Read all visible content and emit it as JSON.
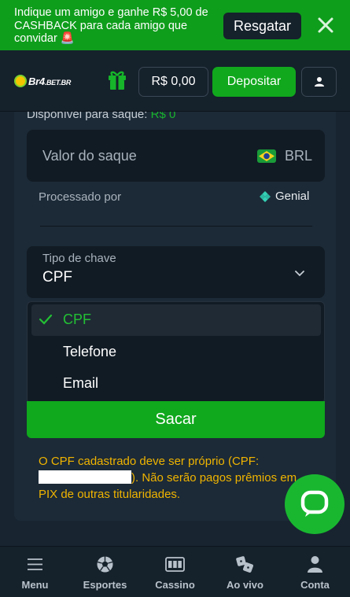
{
  "promo": {
    "text": "Indique um amigo e ganhe R$ 5,00 de CASHBACK para cada amigo que convidar 🚨",
    "button_label": "Resgatar",
    "close_icon": "close-icon"
  },
  "header": {
    "logo_main": "Br4",
    "logo_domain": ".BET.BR",
    "gift_icon": "gift-icon",
    "balance": "R$ 0,00",
    "deposit_label": "Depositar",
    "user_icon": "user-icon"
  },
  "withdraw": {
    "available_label": "Disponível para saque:",
    "available_amount": "R$ 0",
    "amount_placeholder": "Valor do saque",
    "currency": "BRL",
    "processed_label": "Processado por",
    "provider": "Genial",
    "key_type_label": "Tipo de chave",
    "key_type_value": "CPF",
    "submit_label": "Sacar",
    "warning_before": "O CPF cadastrado deve ser próprio (CPF: ",
    "warning_after": "). Não serão pagos prêmios em PIX de outras titularidades."
  },
  "dropdown": {
    "options": [
      {
        "label": "CPF",
        "selected": true
      },
      {
        "label": "Telefone",
        "selected": false
      },
      {
        "label": "Email",
        "selected": false
      }
    ]
  },
  "bottom_nav": {
    "items": [
      {
        "label": "Menu",
        "icon": "menu-icon"
      },
      {
        "label": "Esportes",
        "icon": "soccer-ball-icon"
      },
      {
        "label": "Cassino",
        "icon": "slot-machine-icon"
      },
      {
        "label": "Ao vivo",
        "icon": "dice-icon"
      },
      {
        "label": "Conta",
        "icon": "user-icon"
      }
    ]
  },
  "colors": {
    "brand_green": "#10a81d",
    "background": "#182430",
    "warning": "#f0b400"
  }
}
